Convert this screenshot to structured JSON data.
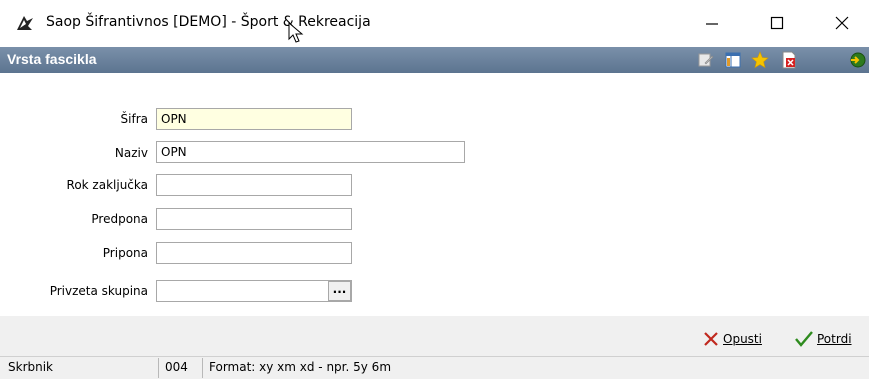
{
  "window": {
    "title": "Saop Šifrantivnos [DEMO] - Šport & Rekreacija",
    "app_icon": "saop-logo-icon",
    "controls": {
      "minimize": "minimize-icon",
      "maximize": "maximize-icon",
      "close": "close-icon"
    }
  },
  "panel": {
    "title": "Vrsta fascikla",
    "toolbar": [
      "edit-note-icon",
      "columns-icon",
      "favorite-star-icon",
      "delete-doc-icon",
      "exit-icon"
    ]
  },
  "form": {
    "sifra": {
      "label": "Šifra",
      "value": "OPN"
    },
    "naziv": {
      "label": "Naziv",
      "value": "OPN"
    },
    "rok_zakljucka": {
      "label": "Rok zaključka",
      "value": ""
    },
    "predpona": {
      "label": "Predpona",
      "value": ""
    },
    "pripona": {
      "label": "Pripona",
      "value": ""
    },
    "privzeta_skupina": {
      "label": "Privzeta skupina",
      "value": "",
      "button": "..."
    }
  },
  "actions": {
    "cancel": "Opusti",
    "confirm": "Potrdi"
  },
  "status": {
    "user": "Skrbnik",
    "code": "004",
    "hint": "Format: xy xm xd - npr. 5y 6m"
  },
  "colors": {
    "header": "#6b82a0",
    "required_field": "#ffffe1",
    "cancel": "#c0281e",
    "confirm": "#2e8b1e"
  }
}
